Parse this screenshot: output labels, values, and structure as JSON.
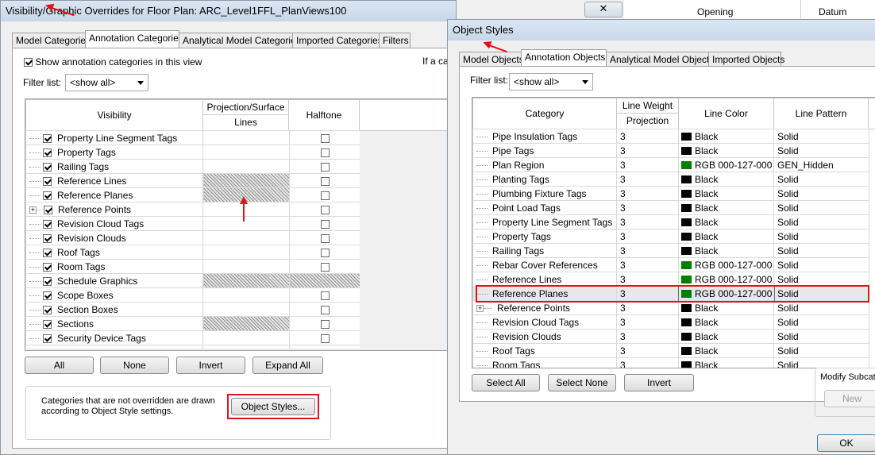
{
  "vg": {
    "title": "Visibility/Graphic Overrides for Floor Plan: ARC_Level1FFL_PlanViews100",
    "tabs": [
      "Model Categories",
      "Annotation Categories",
      "Analytical Model Categories",
      "Imported Categories",
      "Filters"
    ],
    "active_tab": 1,
    "show_checkbox_label": "Show annotation categories in this view",
    "show_checked": true,
    "right_text": "If a ca",
    "filter_label": "Filter list:",
    "filter_value": "<show all>",
    "columns": {
      "visibility": "Visibility",
      "proj": "Projection/Surface",
      "lines": "Lines",
      "halftone": "Halftone"
    },
    "rows": [
      {
        "name": "Property Line Segment Tags",
        "checked": true,
        "expand": false,
        "lines_hatched": false,
        "halftone": "box"
      },
      {
        "name": "Property Tags",
        "checked": true,
        "expand": false,
        "lines_hatched": false,
        "halftone": "box"
      },
      {
        "name": "Railing Tags",
        "checked": true,
        "expand": false,
        "lines_hatched": false,
        "halftone": "box"
      },
      {
        "name": "Reference Lines",
        "checked": true,
        "expand": false,
        "lines_hatched": true,
        "halftone": "box"
      },
      {
        "name": "Reference Planes",
        "checked": true,
        "expand": false,
        "lines_hatched": true,
        "halftone": "box"
      },
      {
        "name": "Reference Points",
        "checked": true,
        "expand": true,
        "lines_hatched": false,
        "halftone": "box"
      },
      {
        "name": "Revision Cloud Tags",
        "checked": true,
        "expand": false,
        "lines_hatched": false,
        "halftone": "box"
      },
      {
        "name": "Revision Clouds",
        "checked": true,
        "expand": false,
        "lines_hatched": false,
        "halftone": "box"
      },
      {
        "name": "Roof Tags",
        "checked": true,
        "expand": false,
        "lines_hatched": false,
        "halftone": "box"
      },
      {
        "name": "Room Tags",
        "checked": true,
        "expand": false,
        "lines_hatched": false,
        "halftone": "box"
      },
      {
        "name": "Schedule Graphics",
        "checked": true,
        "expand": false,
        "lines_hatched": true,
        "halftone": "hatch"
      },
      {
        "name": "Scope Boxes",
        "checked": true,
        "expand": false,
        "lines_hatched": false,
        "halftone": "box"
      },
      {
        "name": "Section Boxes",
        "checked": true,
        "expand": false,
        "lines_hatched": false,
        "halftone": "box"
      },
      {
        "name": "Sections",
        "checked": true,
        "expand": false,
        "lines_hatched": true,
        "halftone": "box"
      },
      {
        "name": "Security Device Tags",
        "checked": true,
        "expand": false,
        "lines_hatched": false,
        "halftone": "box"
      }
    ],
    "buttons": {
      "all": "All",
      "none": "None",
      "invert": "Invert",
      "expand_all": "Expand All"
    },
    "note": "Categories that are not overridden are drawn according to Object Style settings.",
    "object_styles_button": "Object Styles..."
  },
  "bg_headers": {
    "opening": "Opening",
    "datum": "Datum"
  },
  "os": {
    "title": "Object Styles",
    "tabs": [
      "Model Objects",
      "Annotation Objects",
      "Analytical Model Objects",
      "Imported Objects"
    ],
    "active_tab": 1,
    "filter_label": "Filter list:",
    "filter_value": "<show all>",
    "columns": {
      "category": "Category",
      "line_weight": "Line Weight",
      "projection": "Projection",
      "line_color": "Line Color",
      "line_pattern": "Line Pattern"
    },
    "rows": [
      {
        "name": "Pipe Insulation Tags",
        "weight": "3",
        "color": "Black",
        "swatch": "#000000",
        "pattern": "Solid",
        "expand": false,
        "selected": false
      },
      {
        "name": "Pipe Tags",
        "weight": "3",
        "color": "Black",
        "swatch": "#000000",
        "pattern": "Solid",
        "expand": false,
        "selected": false
      },
      {
        "name": "Plan Region",
        "weight": "3",
        "color": "RGB 000-127-000",
        "swatch": "#007f00",
        "pattern": "GEN_Hidden",
        "expand": false,
        "selected": false
      },
      {
        "name": "Planting Tags",
        "weight": "3",
        "color": "Black",
        "swatch": "#000000",
        "pattern": "Solid",
        "expand": false,
        "selected": false
      },
      {
        "name": "Plumbing Fixture Tags",
        "weight": "3",
        "color": "Black",
        "swatch": "#000000",
        "pattern": "Solid",
        "expand": false,
        "selected": false
      },
      {
        "name": "Point Load Tags",
        "weight": "3",
        "color": "Black",
        "swatch": "#000000",
        "pattern": "Solid",
        "expand": false,
        "selected": false
      },
      {
        "name": "Property Line Segment Tags",
        "weight": "3",
        "color": "Black",
        "swatch": "#000000",
        "pattern": "Solid",
        "expand": false,
        "selected": false
      },
      {
        "name": "Property Tags",
        "weight": "3",
        "color": "Black",
        "swatch": "#000000",
        "pattern": "Solid",
        "expand": false,
        "selected": false
      },
      {
        "name": "Railing Tags",
        "weight": "3",
        "color": "Black",
        "swatch": "#000000",
        "pattern": "Solid",
        "expand": false,
        "selected": false
      },
      {
        "name": "Rebar Cover References",
        "weight": "3",
        "color": "RGB 000-127-000",
        "swatch": "#007f00",
        "pattern": "Solid",
        "expand": false,
        "selected": false
      },
      {
        "name": "Reference Lines",
        "weight": "3",
        "color": "RGB 000-127-000",
        "swatch": "#007f00",
        "pattern": "Solid",
        "expand": false,
        "selected": false
      },
      {
        "name": "Reference Planes",
        "weight": "3",
        "color": "RGB 000-127-000",
        "swatch": "#007f00",
        "pattern": "Solid",
        "expand": false,
        "selected": true
      },
      {
        "name": "Reference Points",
        "weight": "3",
        "color": "Black",
        "swatch": "#000000",
        "pattern": "Solid",
        "expand": true,
        "selected": false
      },
      {
        "name": "Revision Cloud Tags",
        "weight": "3",
        "color": "Black",
        "swatch": "#000000",
        "pattern": "Solid",
        "expand": false,
        "selected": false
      },
      {
        "name": "Revision Clouds",
        "weight": "3",
        "color": "Black",
        "swatch": "#000000",
        "pattern": "Solid",
        "expand": false,
        "selected": false
      },
      {
        "name": "Roof Tags",
        "weight": "3",
        "color": "Black",
        "swatch": "#000000",
        "pattern": "Solid",
        "expand": false,
        "selected": false
      },
      {
        "name": "Room Tags",
        "weight": "3",
        "color": "Black",
        "swatch": "#000000",
        "pattern": "Solid",
        "expand": false,
        "selected": false
      }
    ],
    "buttons": {
      "select_all": "Select All",
      "select_none": "Select None",
      "invert": "Invert"
    },
    "modify_label": "Modify Subcate",
    "new_button": "New",
    "ok_button": "OK"
  }
}
